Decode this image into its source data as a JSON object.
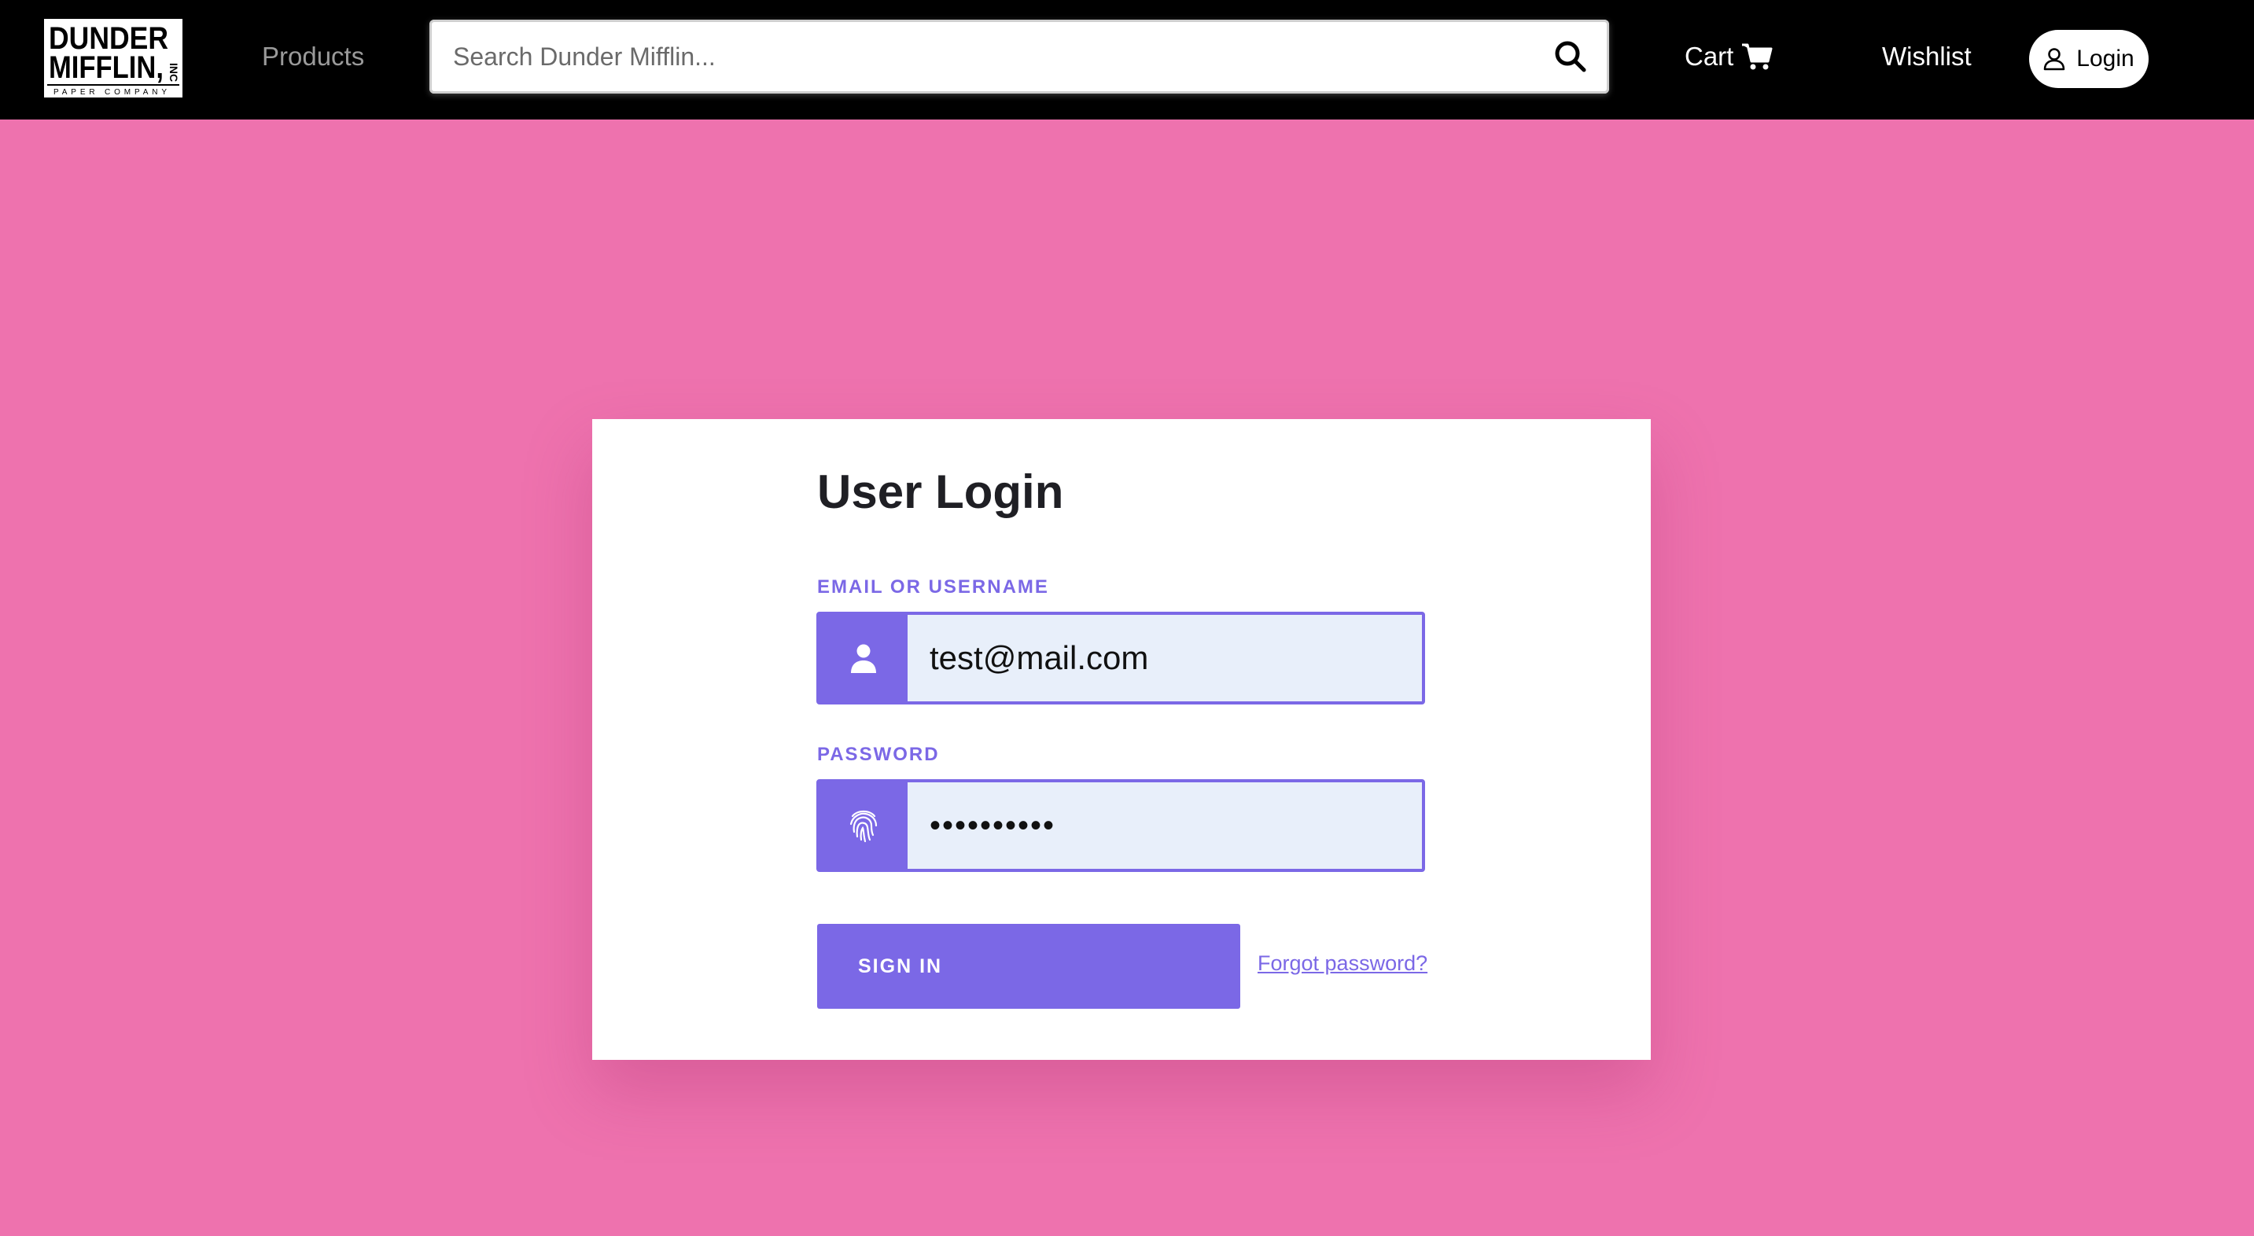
{
  "brand": {
    "logo_line1": "DUNDER",
    "logo_line2": "MIFFLIN,",
    "logo_inc": "INC",
    "logo_tagline": "PAPER COMPANY"
  },
  "nav": {
    "products": "Products",
    "search_placeholder": "Search Dunder Mifflin...",
    "cart": "Cart",
    "wishlist": "Wishlist",
    "login": "Login"
  },
  "login": {
    "title": "User Login",
    "email_label": "EMAIL OR USERNAME",
    "email_value": "test@mail.com",
    "password_label": "PASSWORD",
    "password_value": "••••••••••",
    "signin_label": "SIGN IN",
    "forgot_label": "Forgot password?"
  },
  "colors": {
    "background": "#ee72ae",
    "navbar": "#000000",
    "accent": "#7b68e6",
    "input_fill": "#e8effa"
  },
  "icons": {
    "search": "search-icon",
    "cart": "cart-icon",
    "login": "user-icon",
    "email_field": "user-icon",
    "password_field": "fingerprint-icon"
  }
}
